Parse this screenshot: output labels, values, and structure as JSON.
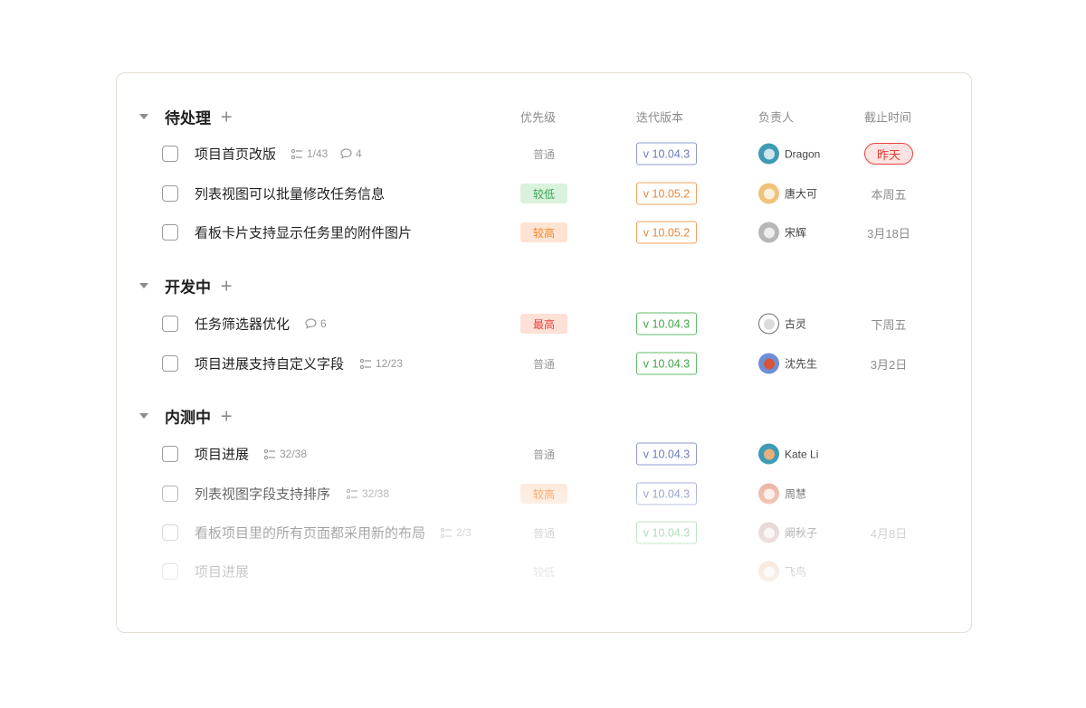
{
  "columns": {
    "priority": "优先级",
    "version": "迭代版本",
    "assignee": "负责人",
    "deadline": "截止时间"
  },
  "groups": [
    {
      "title": "待处理",
      "add": "+",
      "tasks": [
        {
          "title": "项目首页改版",
          "subtasks": "1/43",
          "comments": "4",
          "priority": "普通",
          "version": "v 10.04.3",
          "assignee": "Dragon",
          "deadline": "昨天"
        },
        {
          "title": "列表视图可以批量修改任务信息",
          "priority": "较低",
          "version": "v 10.05.2",
          "assignee": "唐大可",
          "deadline": "本周五"
        },
        {
          "title": "看板卡片支持显示任务里的附件图片",
          "priority": "较高",
          "version": "v 10.05.2",
          "assignee": "宋辉",
          "deadline": "3月18日"
        }
      ]
    },
    {
      "title": "开发中",
      "add": "+",
      "tasks": [
        {
          "title": "任务筛选器优化",
          "comments": "6",
          "priority": "最高",
          "version": "v 10.04.3",
          "assignee": "古灵",
          "deadline": "下周五"
        },
        {
          "title": "项目进展支持自定义字段",
          "subtasks": "12/23",
          "priority": "普通",
          "version": "v 10.04.3",
          "assignee": "沈先生",
          "deadline": "3月2日"
        }
      ]
    },
    {
      "title": "内测中",
      "add": "+",
      "tasks": [
        {
          "title": "项目进展",
          "subtasks": "32/38",
          "priority": "普通",
          "version": "v 10.04.3",
          "assignee": "Kate Li"
        },
        {
          "title": "列表视图字段支持排序",
          "subtasks": "32/38",
          "priority": "较高",
          "version": "v 10.04.3",
          "assignee": "周慧"
        },
        {
          "title": "看板项目里的所有页面都采用新的布局",
          "subtasks": "2/3",
          "priority": "普通",
          "version": "v 10.04.3",
          "assignee": "阚秋子",
          "deadline": "4月8日"
        },
        {
          "title": "项目进展",
          "priority": "较低",
          "assignee": "飞鸟"
        }
      ]
    }
  ],
  "colors": {
    "priority_normal_text": "#9a9a9a",
    "priority_low_bg": "#d9f2dc",
    "priority_low_text": "#3aa355",
    "priority_high_bg": "#fde4d2",
    "priority_high_text": "#f0872c",
    "priority_highest_bg": "#fde1d6",
    "priority_highest_text": "#e8433e",
    "version_blue": "#8e9bd0",
    "version_orange": "#f3a35f",
    "version_green": "#5fbd66",
    "deadline_overdue_bg": "#fde3e1",
    "deadline_overdue_border": "#e8433e",
    "deadline_overdue_text": "#e23c36",
    "deadline_normal_text": "#8c8c8c"
  },
  "avatar_colors": [
    "#3f9bb5",
    "#f0c27a",
    "#b7b7b7",
    "#6f6f6f",
    "#d5543a",
    "#e8b07a",
    "#e9a28a",
    "#c9a6a6",
    "#e0b48f"
  ]
}
